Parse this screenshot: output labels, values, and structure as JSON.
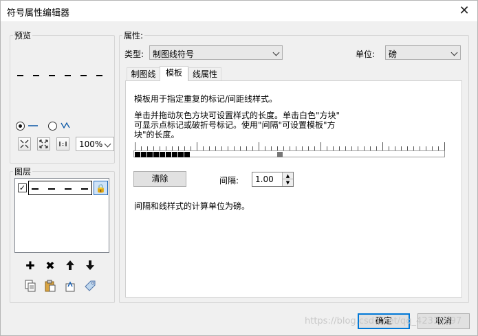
{
  "window": {
    "title": "符号属性编辑器",
    "close_glyph": "✕"
  },
  "preview": {
    "group_label": "预览",
    "zoom_value": "100%",
    "toolbar_icons": [
      "zoom-fit-icon",
      "full-extent-icon",
      "actual-size-icon"
    ]
  },
  "layers": {
    "group_label": "图层",
    "row_checked": true,
    "actions": [
      "add-icon",
      "remove-icon",
      "move-up-icon",
      "move-down-icon"
    ],
    "clip_actions": [
      "copy-icon",
      "paste-icon",
      "undo-icon",
      "tag-icon"
    ]
  },
  "properties": {
    "group_label": "属性:",
    "type_label": "类型:",
    "type_value": "制图线符号",
    "unit_label": "单位:",
    "unit_value": "磅"
  },
  "tabs": [
    {
      "label": "制图线",
      "active": false
    },
    {
      "label": "模板",
      "active": true
    },
    {
      "label": "线属性",
      "active": false
    }
  ],
  "template_tab": {
    "desc1": "模板用于指定重复的标记/间距线样式。",
    "desc2_line1": "单击并拖动灰色方块可设置样式的长度。单击白色\"方块\"",
    "desc2_line2": "可显示点标记或破折号标记。使用\"间隔\"可设置模板\"方",
    "desc2_line3": "块\"的长度。",
    "pattern": [
      1,
      1,
      1,
      1,
      1,
      1,
      1,
      1,
      1,
      0,
      0,
      0,
      0,
      0,
      0,
      0,
      0,
      0,
      0,
      0,
      0,
      0,
      0,
      2
    ],
    "clear_label": "清除",
    "interval_label": "间隔:",
    "interval_value": "1.00",
    "note": "间隔和线样式的计算单位为磅。"
  },
  "footer": {
    "ok_label": "确定",
    "cancel_label": "取消"
  },
  "watermark": "https://blog.csdn.net/qq_42330697"
}
